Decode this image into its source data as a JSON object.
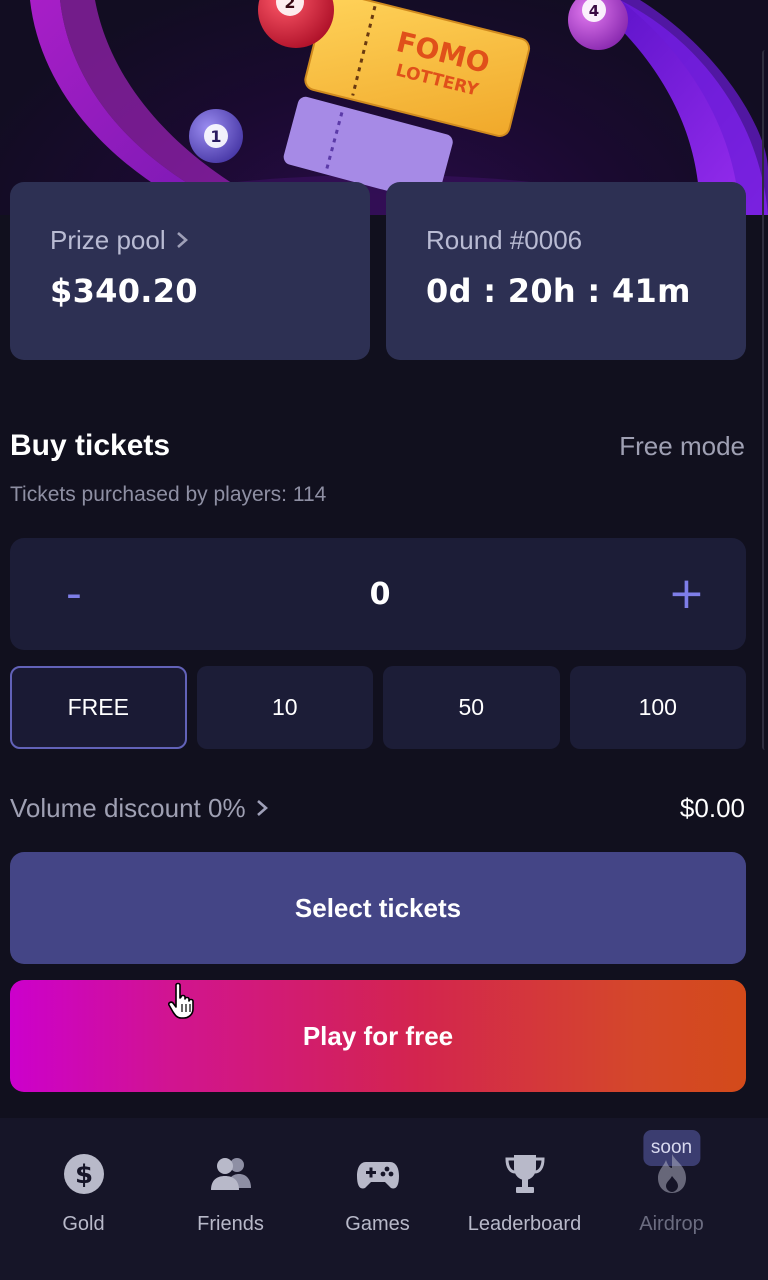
{
  "hero": {
    "ticket_line1": "FOMO",
    "ticket_line2": "LOTTERY",
    "balls": [
      "1",
      "2",
      "4"
    ]
  },
  "prize_pool": {
    "label": "Prize pool",
    "value": "$340.20"
  },
  "round": {
    "label": "Round #0006",
    "countdown": "0d : 20h : 41m"
  },
  "buy": {
    "title": "Buy tickets",
    "mode": "Free mode",
    "purchased_text": "Tickets purchased by players: 114",
    "stepper": {
      "minus": "-",
      "value": "0",
      "plus": "+"
    },
    "quick_options": [
      "FREE",
      "10",
      "50",
      "100"
    ],
    "selected_option": "FREE",
    "discount_label": "Volume discount 0%",
    "total": "$0.00",
    "select_button": "Select tickets",
    "play_button": "Play for free"
  },
  "nav": {
    "items": [
      {
        "label": "Gold",
        "icon": "dollar-coin-icon"
      },
      {
        "label": "Friends",
        "icon": "users-icon"
      },
      {
        "label": "Games",
        "icon": "gamepad-icon"
      },
      {
        "label": "Leaderboard",
        "icon": "trophy-icon"
      },
      {
        "label": "Airdrop",
        "icon": "flame-icon",
        "badge": "soon"
      }
    ]
  },
  "colors": {
    "background": "#11101e",
    "card": "#2d3053",
    "accent": "#7e7ee8",
    "select_button": "#444586",
    "play_gradient_start": "#cc00cc",
    "play_gradient_end": "#d34a1a"
  }
}
